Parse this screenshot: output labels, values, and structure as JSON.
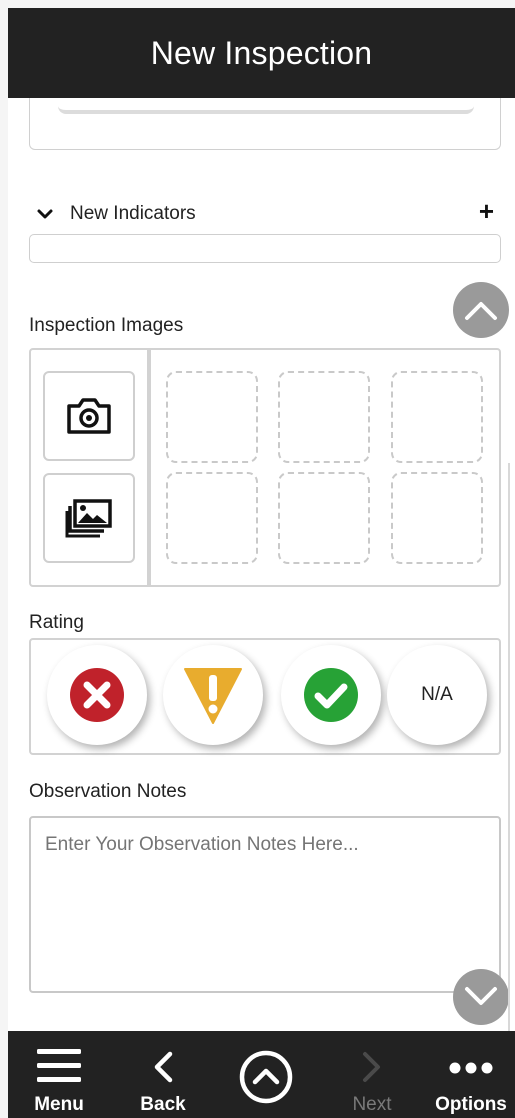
{
  "header": {
    "title": "New Inspection"
  },
  "indicators": {
    "label": "New Indicators",
    "add_icon": "plus-icon"
  },
  "images": {
    "label": "Inspection Images",
    "camera_icon": "camera-icon",
    "gallery_icon": "gallery-icon"
  },
  "rating": {
    "label": "Rating",
    "options": [
      {
        "icon": "fail-x-icon",
        "color": "#c0222b"
      },
      {
        "icon": "warning-icon",
        "color": "#e8ac2e"
      },
      {
        "icon": "pass-check-icon",
        "color": "#27a236"
      },
      {
        "text": "N/A"
      }
    ]
  },
  "notes": {
    "label": "Observation Notes",
    "placeholder": "Enter Your Observation Notes Here..."
  },
  "nav": {
    "menu": "Menu",
    "back": "Back",
    "next": "Next",
    "options": "Options"
  },
  "colors": {
    "header_bg": "#222222",
    "scroll_button": "#9a9a9a"
  }
}
